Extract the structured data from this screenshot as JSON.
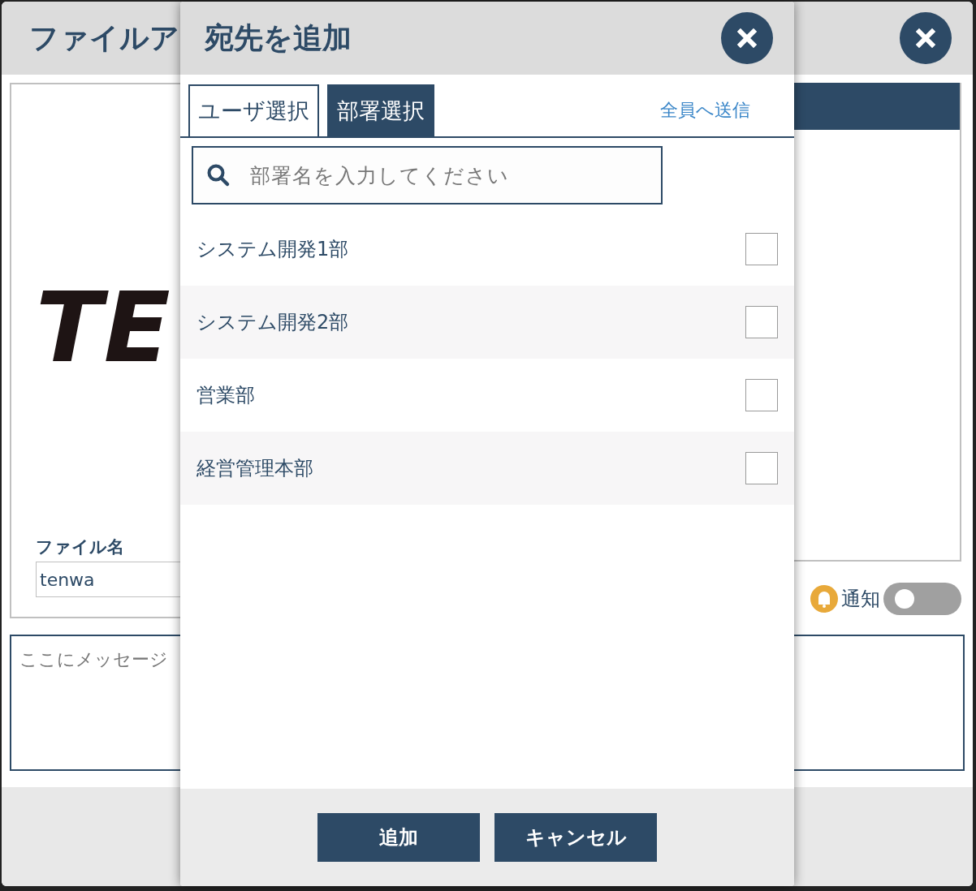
{
  "window": {
    "title": "ファイルア",
    "preview_text": "TE",
    "file_name_label": "ファイル名",
    "file_name": "tenwa",
    "notify": {
      "label": "通知",
      "on": false
    },
    "message_placeholder": "ここにメッセージ"
  },
  "dialog": {
    "title": "宛先を追加",
    "tabs": [
      {
        "label": "ユーザ選択",
        "selected": false
      },
      {
        "label": "部署選択",
        "selected": true
      }
    ],
    "send_all_link": "全員へ送信",
    "search": {
      "placeholder": "部署名を入力してください"
    },
    "departments": [
      {
        "name": "システム開発1部",
        "checked": false
      },
      {
        "name": "システム開発2部",
        "checked": false
      },
      {
        "name": "営業部",
        "checked": false
      },
      {
        "name": "経営管理本部",
        "checked": false
      }
    ],
    "buttons": [
      "追加",
      "キャンセル"
    ]
  }
}
